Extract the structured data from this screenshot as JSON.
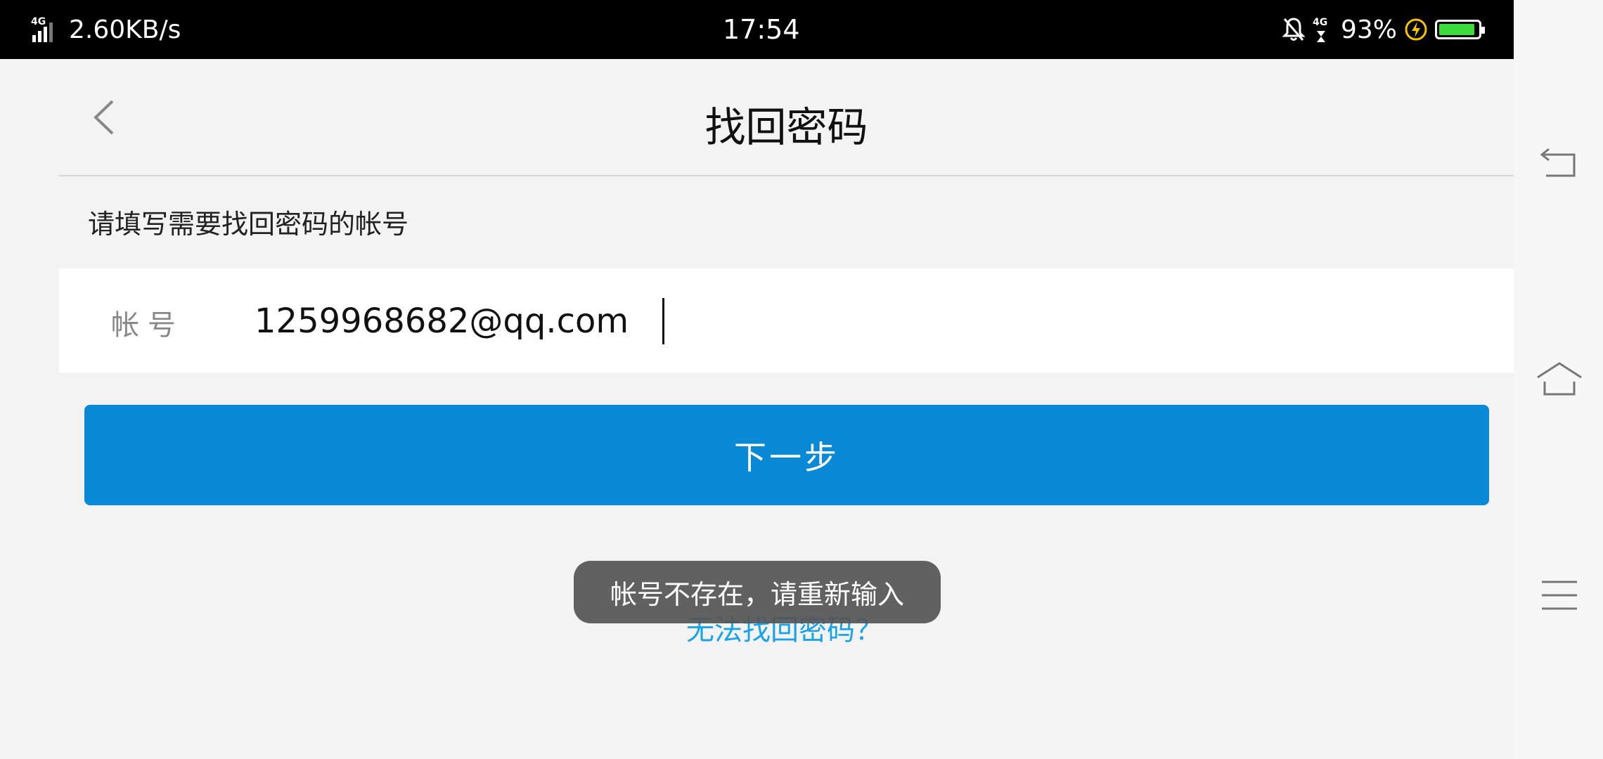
{
  "status_bar": {
    "network_type": "4G",
    "net_speed": "2.60KB/s",
    "clock": "17:54",
    "right_network_type": "4G",
    "battery_percent": "93%",
    "battery_level": 0.93,
    "battery_color": "#3ddc3d"
  },
  "header": {
    "title": "找回密码",
    "back_icon": "chevron-left-icon"
  },
  "form": {
    "instruction": "请填写需要找回密码的帐号",
    "account_label": "帐号",
    "account_value": "1259968682@qq.com"
  },
  "next_button": {
    "label": "下一步",
    "color": "#0a8ad6"
  },
  "recover_link": {
    "label": "无法找回密码？",
    "color": "#1aa3e8"
  },
  "toast": {
    "message": "帐号不存在，请重新输入"
  },
  "nav_bar": {
    "back_icon": "back-arrow-icon",
    "home_icon": "home-icon",
    "menu_icon": "menu-icon"
  }
}
